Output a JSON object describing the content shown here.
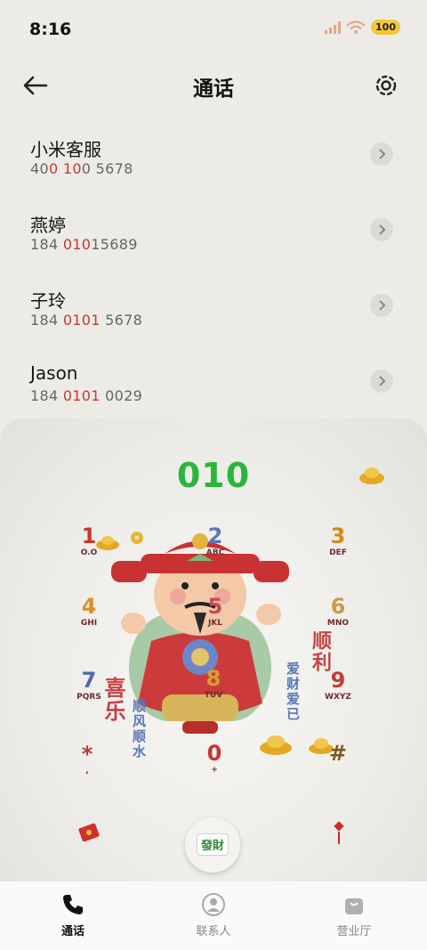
{
  "status": {
    "time": "8:16",
    "battery": "100"
  },
  "header": {
    "title": "通话"
  },
  "contacts": [
    {
      "name": "小米客服",
      "num_pre": "40",
      "num_hl": "0 10",
      "num_post": "0 5678"
    },
    {
      "name": "燕婷",
      "num_pre": "184 ",
      "num_hl": "010",
      "num_post": "15689"
    },
    {
      "name": "子玲",
      "num_pre": "184 ",
      "num_hl": "0101",
      "num_post": " 5678"
    },
    {
      "name": "Jason",
      "num_pre": "184 ",
      "num_hl": "0101",
      "num_post": " 0029"
    }
  ],
  "dialer": {
    "display": "010",
    "keys": [
      {
        "digit": "1",
        "letters": "O.O"
      },
      {
        "digit": "2",
        "letters": "ABC"
      },
      {
        "digit": "3",
        "letters": "DEF"
      },
      {
        "digit": "4",
        "letters": "GHI"
      },
      {
        "digit": "5",
        "letters": "JKL"
      },
      {
        "digit": "6",
        "letters": "MNO"
      },
      {
        "digit": "7",
        "letters": "PQRS"
      },
      {
        "digit": "8",
        "letters": "TUV"
      },
      {
        "digit": "9",
        "letters": "WXYZ"
      },
      {
        "digit": "*",
        "letters": ","
      },
      {
        "digit": "0",
        "letters": "+"
      },
      {
        "digit": "#",
        "letters": ""
      }
    ],
    "deco": {
      "xile": "喜乐",
      "shunfeng": "顺风顺水",
      "aicai": "爱财爱已",
      "shunli": "顺利",
      "facai": "發財"
    }
  },
  "nav": [
    {
      "label": "通话",
      "icon": "phone-icon",
      "active": true
    },
    {
      "label": "联系人",
      "icon": "person-icon",
      "active": false
    },
    {
      "label": "营业厅",
      "icon": "bag-icon",
      "active": false
    }
  ],
  "colors": {
    "accent_green": "#2ab63c",
    "highlight_red": "#c23a32",
    "background": "#ecebe6"
  }
}
